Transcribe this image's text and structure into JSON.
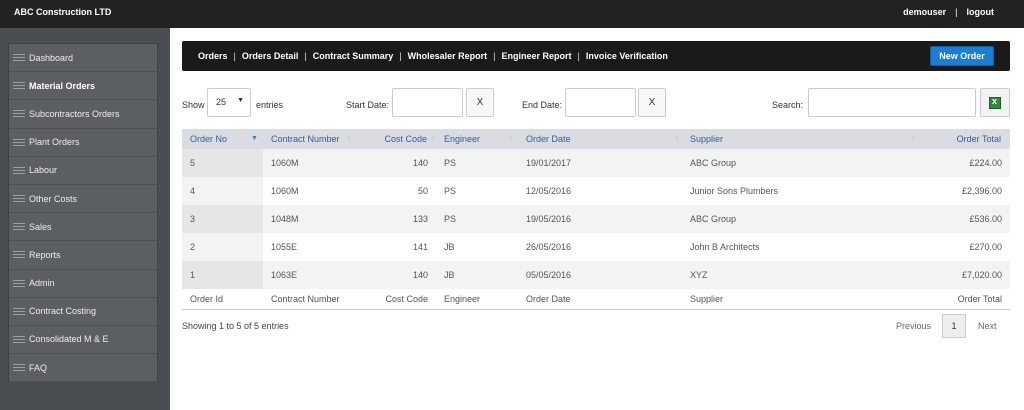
{
  "app": {
    "title": "ABC Construction LTD"
  },
  "user": {
    "name": "demouser",
    "separator": "|",
    "logout": "logout"
  },
  "sidebar": {
    "items": [
      {
        "label": "Dashboard"
      },
      {
        "label": "Material Orders"
      },
      {
        "label": "Subcontractors Orders"
      },
      {
        "label": "Plant Orders"
      },
      {
        "label": "Labour"
      },
      {
        "label": "Other Costs"
      },
      {
        "label": "Sales"
      },
      {
        "label": "Reports"
      },
      {
        "label": "Admin"
      },
      {
        "label": "Contract Costing"
      },
      {
        "label": "Consolidated M & E"
      },
      {
        "label": "FAQ"
      }
    ],
    "active": "Material Orders"
  },
  "nav": {
    "links": [
      {
        "label": "Orders"
      },
      {
        "label": "Orders Detail"
      },
      {
        "label": "Contract Summary"
      },
      {
        "label": "Wholesaler Report"
      },
      {
        "label": "Engineer Report"
      },
      {
        "label": "Invoice Verification"
      }
    ],
    "separator": "|",
    "new_order": "New Order"
  },
  "controls": {
    "show_label": "Show",
    "entries_value": "25",
    "entries_label": "entries",
    "start_date_label": "Start Date:",
    "end_date_label": "End Date:",
    "clear_label": "X",
    "search_label": "Search:"
  },
  "table": {
    "headers": [
      "Order No",
      "Contract Number",
      "Cost Code",
      "Engineer",
      "Order Date",
      "Supplier",
      "Order Total"
    ],
    "rows": [
      [
        "5",
        "1060M",
        "140",
        "PS",
        "19/01/2017",
        "ABC Group",
        "£224.00"
      ],
      [
        "4",
        "1060M",
        "50",
        "PS",
        "12/05/2016",
        "Junior Sons Plumbers",
        "£2,396.00"
      ],
      [
        "3",
        "1048M",
        "133",
        "PS",
        "19/05/2016",
        "ABC Group",
        "£536.00"
      ],
      [
        "2",
        "1055E",
        "141",
        "JB",
        "26/05/2016",
        "John B Architects",
        "£270.00"
      ],
      [
        "1",
        "1063E",
        "140",
        "JB",
        "05/05/2016",
        "XYZ",
        "£7,020.00"
      ]
    ],
    "footers": [
      "Order Id",
      "Contract Number",
      "Cost Code",
      "Engineer",
      "Order Date",
      "Supplier",
      "Order Total"
    ]
  },
  "info": "Showing 1 to 5 of 5 entries",
  "pager": {
    "previous": "Previous",
    "page": "1",
    "next": "Next"
  }
}
